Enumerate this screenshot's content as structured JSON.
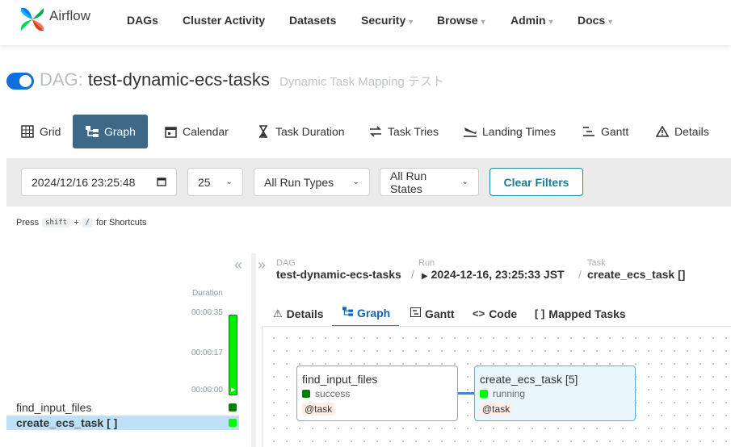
{
  "navbar": {
    "brand": "Airflow",
    "items": [
      {
        "label": "DAGs",
        "dropdown": false
      },
      {
        "label": "Cluster Activity",
        "dropdown": false
      },
      {
        "label": "Datasets",
        "dropdown": false
      },
      {
        "label": "Security",
        "dropdown": true
      },
      {
        "label": "Browse",
        "dropdown": true
      },
      {
        "label": "Admin",
        "dropdown": true
      },
      {
        "label": "Docs",
        "dropdown": true
      }
    ]
  },
  "dag": {
    "prefix": "DAG:",
    "name": "test-dynamic-ecs-tasks",
    "description": "Dynamic Task Mapping テスト",
    "paused": false
  },
  "main_tabs": [
    {
      "label": "Grid",
      "icon": "grid-icon",
      "active": false
    },
    {
      "label": "Graph",
      "icon": "graph-icon",
      "active": true
    },
    {
      "label": "Calendar",
      "icon": "calendar-icon",
      "active": false
    },
    {
      "label": "Task Duration",
      "icon": "hourglass-icon",
      "active": false
    },
    {
      "label": "Task Tries",
      "icon": "retry-icon",
      "active": false
    },
    {
      "label": "Landing Times",
      "icon": "landing-icon",
      "active": false
    },
    {
      "label": "Gantt",
      "icon": "gantt-icon",
      "active": false
    },
    {
      "label": "Details",
      "icon": "warning-icon",
      "active": false
    }
  ],
  "filters": {
    "datetime": "2024/12/16  23:25:48",
    "num_runs": "25",
    "run_type": "All Run Types",
    "run_state": "All Run States",
    "clear_label": "Clear Filters"
  },
  "shortcut": {
    "press": "Press",
    "key1": "shift",
    "plus": "+",
    "key2": "/",
    "suffix": "for Shortcuts"
  },
  "grid": {
    "duration_label": "Duration",
    "ticks": [
      "00:00:35",
      "00:00:17",
      "00:00:00"
    ],
    "tasks": [
      {
        "name": "find_input_files",
        "state": "success",
        "selected": false
      },
      {
        "name": "create_ecs_task [ ]",
        "state": "running",
        "selected": true
      }
    ]
  },
  "breadcrumb": {
    "dag_label": "DAG",
    "dag_value": "test-dynamic-ecs-tasks",
    "run_label": "Run",
    "run_value": "2024-12-16, 23:25:33 JST",
    "task_label": "Task",
    "task_value": "create_ecs_task []"
  },
  "sub_tabs": [
    {
      "label": "Details",
      "icon": "warning-icon",
      "active": false
    },
    {
      "label": "Graph",
      "icon": "graph-icon",
      "active": true
    },
    {
      "label": "Gantt",
      "icon": "gantt-icon",
      "active": false
    },
    {
      "label": "Code",
      "icon": "code-icon",
      "active": false
    },
    {
      "label": "Mapped Tasks",
      "icon": "brackets-icon",
      "active": false
    }
  ],
  "graph": {
    "nodes": [
      {
        "name": "find_input_files",
        "state": "success",
        "operator": "@task"
      },
      {
        "name": "create_ecs_task [5]",
        "state": "running",
        "operator": "@task"
      }
    ]
  },
  "colors": {
    "success": "#008000",
    "running": "#00ff00",
    "active_tab": "#3d6888",
    "accent": "#1a74c8"
  }
}
